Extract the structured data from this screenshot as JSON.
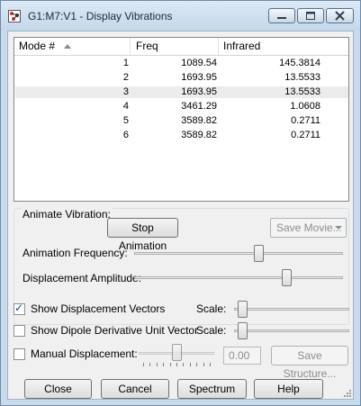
{
  "window": {
    "title": "G1:M7:V1 - Display Vibrations"
  },
  "table": {
    "headers": [
      "Mode #",
      "Freq",
      "Infrared"
    ],
    "rows": [
      {
        "mode": "1",
        "freq": "1089.54",
        "ir": "145.3814"
      },
      {
        "mode": "2",
        "freq": "1693.95",
        "ir": "13.5533"
      },
      {
        "mode": "3",
        "freq": "1693.95",
        "ir": "13.5533"
      },
      {
        "mode": "4",
        "freq": "3461.29",
        "ir": "1.0608"
      },
      {
        "mode": "5",
        "freq": "3589.82",
        "ir": "0.2711"
      },
      {
        "mode": "6",
        "freq": "3589.82",
        "ir": "0.2711"
      }
    ],
    "selected_row": 3
  },
  "animate": {
    "group_label": "Animate Vibration:",
    "stop_button": "Stop Animation",
    "save_movie": "Save Movie...",
    "frequency_label": "Animation Frequency:",
    "frequency_level": 0.6,
    "amplitude_label": "Displacement Amplitude:",
    "amplitude_level": 0.74
  },
  "options": {
    "show_displacement": {
      "label": "Show Displacement Vectors",
      "checked": true,
      "scale_label": "Scale:",
      "scale_level": 0.03
    },
    "show_dipole": {
      "label": "Show Dipole Derivative Unit Vector",
      "checked": false,
      "scale_label": "Scale:",
      "scale_level": 0.03
    },
    "manual": {
      "label": "Manual Displacement:",
      "checked": false,
      "value": "0.00",
      "level": 0.5,
      "save_structure": "Save Structure..."
    }
  },
  "buttons": {
    "close": "Close",
    "cancel": "Cancel",
    "spectrum": "Spectrum",
    "help": "Help"
  },
  "colors": {
    "title_bar": "#c9daea",
    "dialog_bg": "#f0f0f0",
    "selected_row": "#ececec",
    "check_mark": "#1e3f8a"
  }
}
